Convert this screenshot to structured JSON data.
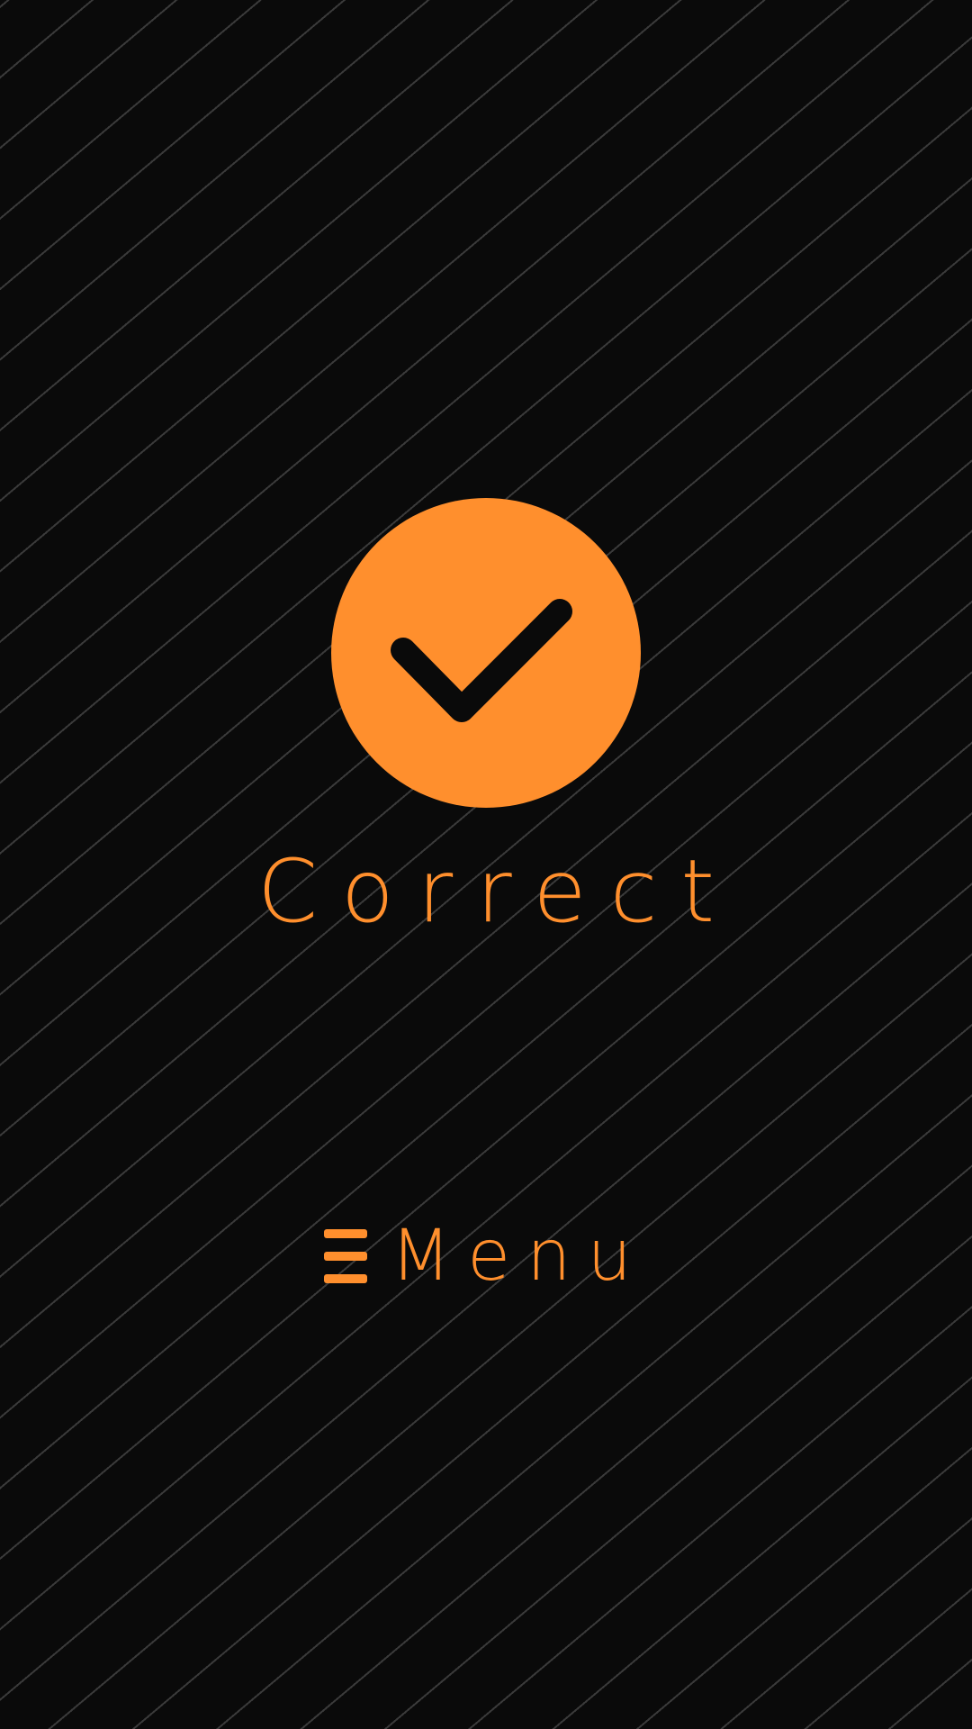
{
  "result": {
    "label": "Correct",
    "icon": "checkmark-icon"
  },
  "menu": {
    "label": "Menu",
    "icon": "hamburger-menu-icon"
  },
  "colors": {
    "accent": "#ff8f2d",
    "background": "#0a0a0a",
    "stripe": "#3a3a3a",
    "check": "#0a0a0a"
  }
}
